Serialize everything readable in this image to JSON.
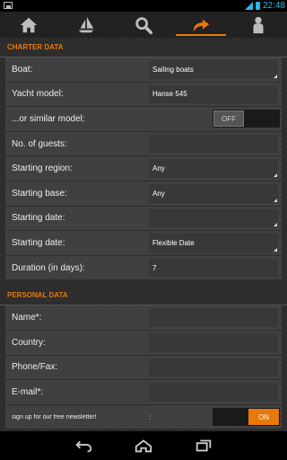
{
  "status_bar": {
    "time": "22:48"
  },
  "nav_tabs": [
    {
      "name": "home",
      "icon": "home-icon",
      "active": false
    },
    {
      "name": "sailboat",
      "icon": "sailboat-icon",
      "active": false
    },
    {
      "name": "search",
      "icon": "search-icon",
      "active": false
    },
    {
      "name": "share",
      "icon": "share-arrow-icon",
      "active": true
    },
    {
      "name": "person",
      "icon": "person-icon",
      "active": false
    }
  ],
  "accent_color": "#e8780a",
  "charter": {
    "title": "CHARTER DATA",
    "rows": [
      {
        "label": "Boat:",
        "value": "Sailing boats",
        "type": "select"
      },
      {
        "label": "Yacht model:",
        "value": "Hanse 545",
        "type": "input"
      },
      {
        "label": "...or similar model:",
        "toggle": "OFF",
        "type": "toggle"
      },
      {
        "label": "No. of guests:",
        "value": "",
        "type": "input"
      },
      {
        "label": "Starting region:",
        "value": "Any",
        "type": "select"
      },
      {
        "label": "Starting base:",
        "value": "Any",
        "type": "select"
      },
      {
        "label": "Starting date:",
        "value": "",
        "type": "select"
      },
      {
        "label": "Starting date:",
        "value": "Flexible Date",
        "type": "select"
      },
      {
        "label": "Duration (in days):",
        "value": "7",
        "type": "input"
      }
    ]
  },
  "personal": {
    "title": "PERSONAL DATA",
    "rows": [
      {
        "label": "Name*:",
        "value": ""
      },
      {
        "label": "Country:",
        "value": ""
      },
      {
        "label": "Phone/Fax:",
        "value": ""
      },
      {
        "label": "E-mail*:",
        "value": ""
      }
    ],
    "newsletter": {
      "label": "sign up for our free newsletter!",
      "colon": ":",
      "toggle": "ON"
    }
  },
  "system_nav": {
    "buttons": [
      "back-icon",
      "home-icon",
      "recent-apps-icon"
    ]
  }
}
